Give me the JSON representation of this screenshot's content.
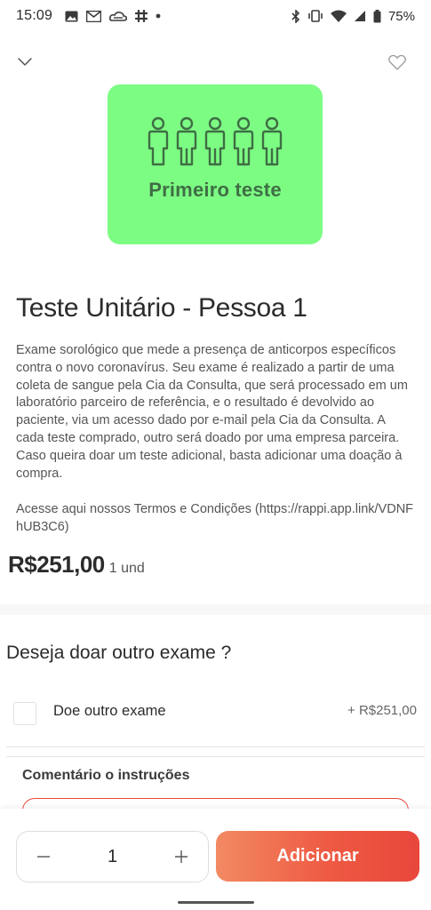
{
  "status_bar": {
    "time": "15:09",
    "battery": "75%",
    "left_icons": [
      "image-icon",
      "gmail-icon",
      "cloud-icon",
      "slack-icon",
      "dot-icon"
    ],
    "right_icons": [
      "bluetooth-icon",
      "vibrate-icon",
      "wifi-icon",
      "signal-icon",
      "battery-icon"
    ]
  },
  "product": {
    "image_caption": "Primeiro teste",
    "image_bg_color": "#7dfc84",
    "image_text_color": "#3f6e44",
    "title": "Teste Unitário - Pessoa 1",
    "description": "Exame sorológico que mede a presença de anticorpos específicos contra o novo coronavírus. Seu exame é realizado a partir de uma coleta de sangue pela Cia da Consulta, que será processado em um laboratório parceiro de referência, e o resultado é devolvido ao paciente, via um acesso dado por e-mail pela Cia da Consulta. A cada teste comprado, outro será doado por uma empresa parceira. Caso queira doar um teste adicional, basta adicionar uma doação à compra.",
    "terms": "Acesse aqui nossos Termos e Condições (https://rappi.app.link/VDNFhUB3C6)",
    "price": "R$251,00",
    "unit": "1 und"
  },
  "donate": {
    "heading": "Deseja doar outro exame ?",
    "option_label": "Doe outro exame",
    "option_price": "+ R$251,00"
  },
  "comment": {
    "label": "Comentário o instruções"
  },
  "bottom": {
    "quantity": "1",
    "add_label": "Adicionar",
    "accent_color": "#e8473b"
  }
}
